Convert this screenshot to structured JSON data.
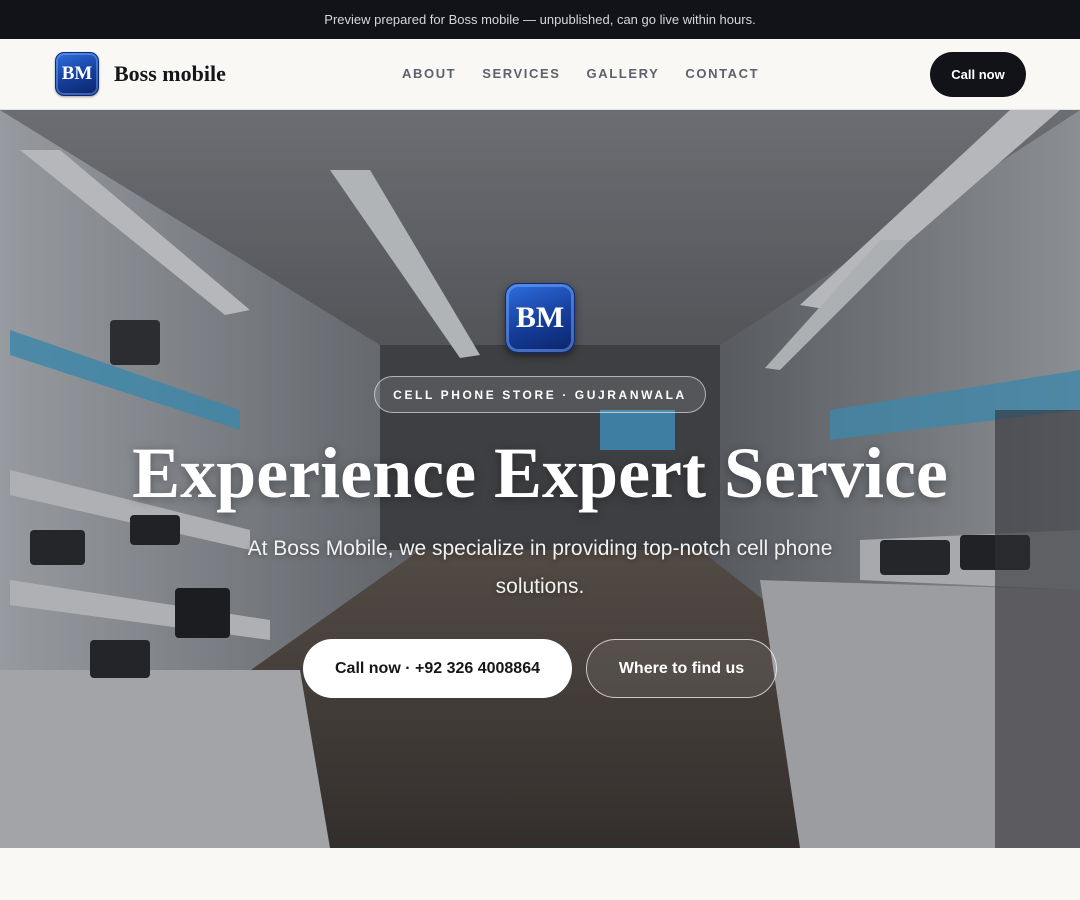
{
  "topbar": {
    "notice": "Preview prepared for Boss mobile — unpublished, can go live within hours."
  },
  "brand": {
    "logo_text": "BM",
    "name": "Boss mobile"
  },
  "nav": {
    "items": [
      "ABOUT",
      "SERVICES",
      "GALLERY",
      "CONTACT"
    ],
    "call_label": "Call now"
  },
  "hero": {
    "logo_text": "BM",
    "tag": "CELL PHONE STORE · GUJRANWALA",
    "title": "Experience Expert Service",
    "subtitle": "At Boss Mobile, we specialize in providing top-notch cell phone solutions.",
    "primary_cta": "Call now · +92 326 4008864",
    "secondary_cta": "Where to find us"
  },
  "colors": {
    "dark": "#111318",
    "accent_blue": "#1d4fc4",
    "background": "#f9f8f5"
  }
}
